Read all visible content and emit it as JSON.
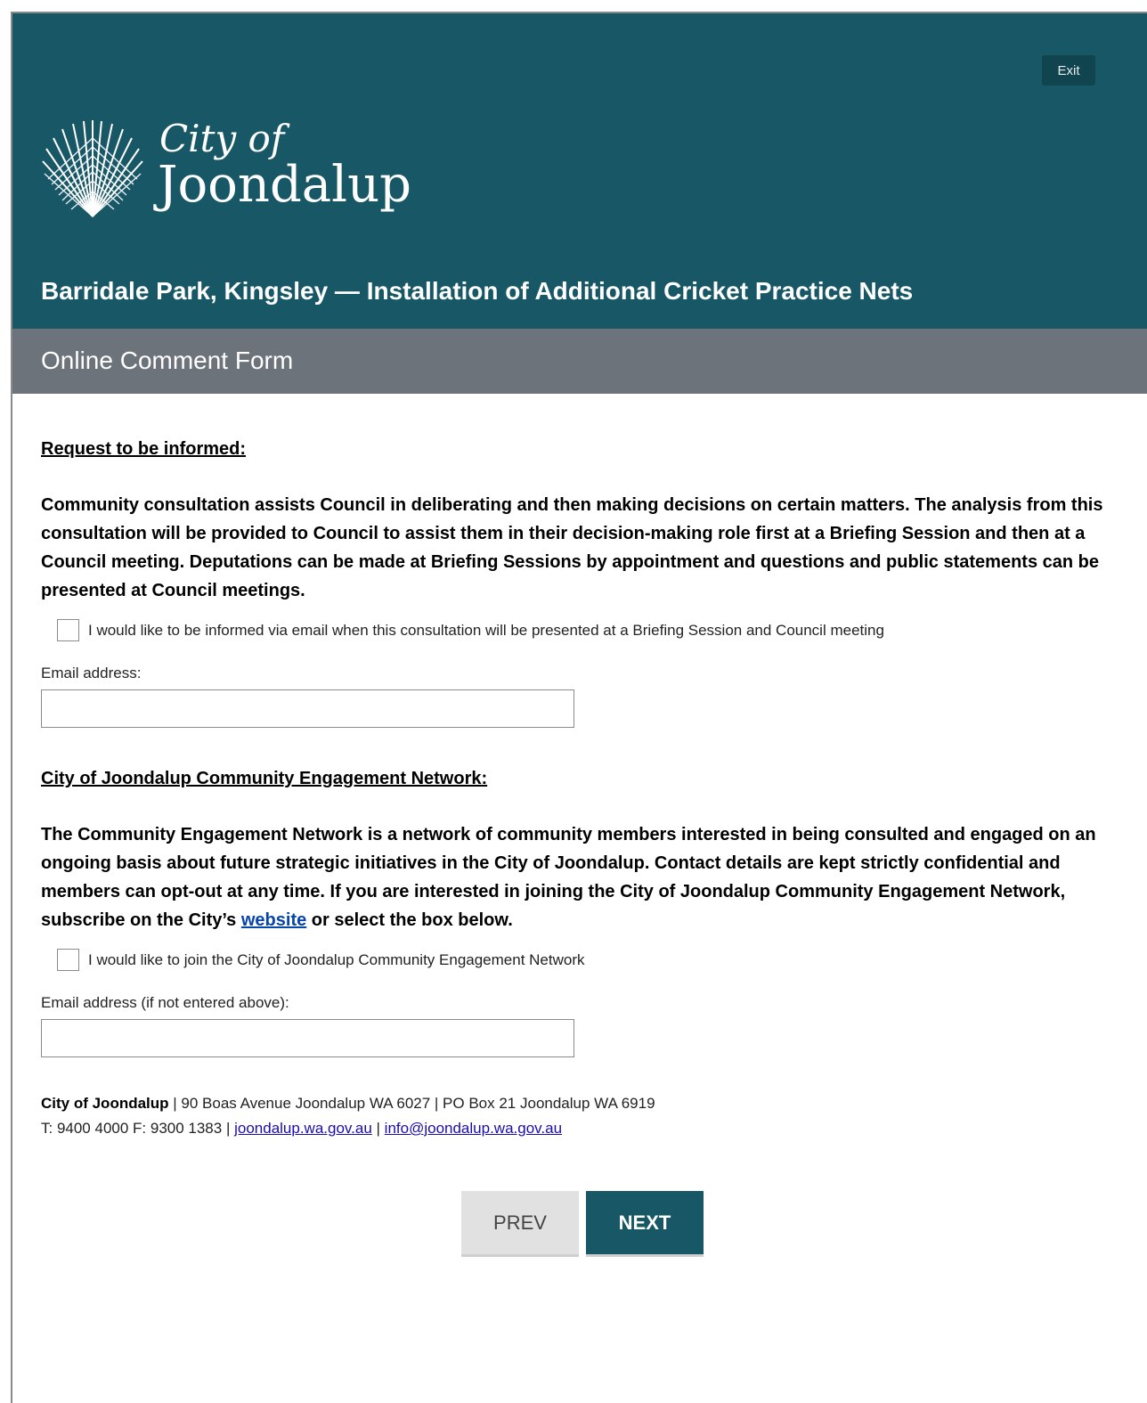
{
  "header": {
    "exit_label": "Exit",
    "logo": {
      "line1": "City of",
      "line2": "Joondalup",
      "icon": "joondalup-fan-logo"
    },
    "project_title": "Barridale Park, Kingsley — Installation of Additional Cricket Practice Nets",
    "form_title": "Online Comment Form"
  },
  "colors": {
    "header_bg": "#175766",
    "subheader_bg": "#6c737a",
    "next_button_bg": "#175766",
    "prev_button_bg": "#e1e1e1"
  },
  "inform_section": {
    "heading": "Request to be informed:",
    "body": "Community consultation assists Council in deliberating and then making decisions on certain matters. The analysis from this consultation will be provided to Council to assist them in their decision-making role first at a Briefing Session and then at a Council meeting. Deputations can be made at Briefing Sessions by appointment and questions and public statements can be presented at Council meetings.",
    "checkbox_label": "I would like to be informed via email when this consultation will be presented at a Briefing Session and Council meeting",
    "checkbox_checked": false,
    "email_label": "Email address:",
    "email_value": ""
  },
  "network_section": {
    "heading": "City of Joondalup Community Engagement Network:",
    "body_before_link": "The Community Engagement Network is a network of community members interested in being consulted and engaged on an ongoing basis about future strategic initiatives in the City of Joondalup. Contact details are kept strictly confidential and members can opt-out at any time. If you are interested in joining the City of Joondalup Community Engagement Network, subscribe on the City’s ",
    "link_text": "website",
    "body_after_link": " or select the box below.",
    "checkbox_label": "I would like to join the City of Joondalup Community Engagement Network",
    "checkbox_checked": false,
    "email_label": "Email address (if not entered above):",
    "email_value": ""
  },
  "footer": {
    "org_name": "City of Joondalup",
    "address": " | 90 Boas Avenue Joondalup WA 6027 | PO Box 21 Joondalup WA 6919",
    "phone_fax": "T: 9400 4000 F: 9300 1383 | ",
    "website_link": "joondalup.wa.gov.au",
    "separator": " | ",
    "email_link": "info@joondalup.wa.gov.au"
  },
  "nav": {
    "prev_label": "PREV",
    "next_label": "NEXT"
  }
}
